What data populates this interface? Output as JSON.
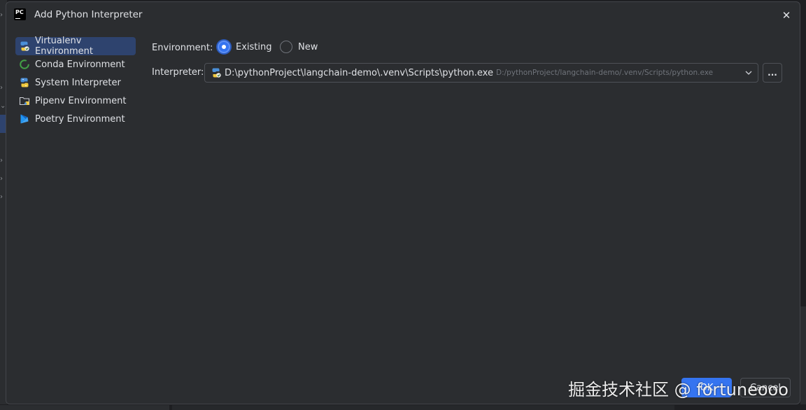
{
  "dialog": {
    "title": "Add Python Interpreter",
    "logo_text": "PC"
  },
  "sidebar": {
    "items": [
      {
        "label": "Virtualenv Environment",
        "icon": "virtualenv-icon",
        "selected": true
      },
      {
        "label": "Conda Environment",
        "icon": "conda-icon",
        "selected": false
      },
      {
        "label": "System Interpreter",
        "icon": "python-icon",
        "selected": false
      },
      {
        "label": "Pipenv Environment",
        "icon": "pipenv-folder-icon",
        "selected": false
      },
      {
        "label": "Poetry Environment",
        "icon": "poetry-icon",
        "selected": false
      }
    ]
  },
  "form": {
    "environment_label": "Environment:",
    "radio_existing": "Existing",
    "radio_new": "New",
    "selected_environment": "Existing",
    "interpreter_label": "Interpreter:",
    "interpreter_path": "D:\\pythonProject\\langchain-demo\\.venv\\Scripts\\python.exe",
    "interpreter_hint": "D:/pythonProject/langchain-demo/.venv/Scripts/python.exe",
    "browse_label": "..."
  },
  "footer": {
    "ok_label": "OK",
    "cancel_label": "Cancel"
  },
  "watermark": "掘金技术社区 @ fortuneooo",
  "colors": {
    "background": "#2b2d30",
    "accent": "#3574f0",
    "selection": "#2e436e",
    "text": "#dfe1e5",
    "muted_text": "#6f737a"
  }
}
